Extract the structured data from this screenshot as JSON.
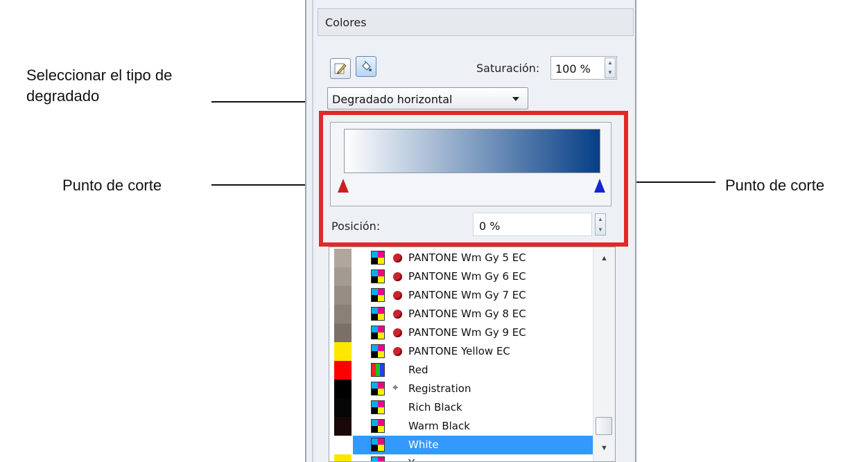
{
  "annotations": {
    "gradient_type_line1": "Seleccionar el tipo de",
    "gradient_type_line2": "degradado",
    "cut_point_left": "Punto de corte",
    "cut_point_right": "Punto de corte"
  },
  "panel": {
    "title": "Colores",
    "saturation_label": "Saturación:",
    "saturation_value": "100 %",
    "gradient_type": "Degradado horizontal",
    "position_label": "Posición:",
    "position_value": "0 %"
  },
  "gradient": {
    "start_color": "#ffffff",
    "end_color": "#063f86",
    "start_stop_color": "#cc1f1f",
    "end_stop_color": "#1428c8"
  },
  "swatches": [
    {
      "name": "PANTONE Wm Gy 5 EC",
      "color": "#b0a69d",
      "mode": "cmyk",
      "spot": true
    },
    {
      "name": "PANTONE Wm Gy 6 EC",
      "color": "#a39a91",
      "mode": "cmyk",
      "spot": true
    },
    {
      "name": "PANTONE Wm Gy 7 EC",
      "color": "#978d84",
      "mode": "cmyk",
      "spot": true
    },
    {
      "name": "PANTONE Wm Gy 8 EC",
      "color": "#8b8077",
      "mode": "cmyk",
      "spot": true
    },
    {
      "name": "PANTONE Wm Gy 9 EC",
      "color": "#7b6f66",
      "mode": "cmyk",
      "spot": true
    },
    {
      "name": "PANTONE Yellow EC",
      "color": "#ffe600",
      "mode": "cmyk",
      "spot": true
    },
    {
      "name": "Red",
      "color": "#ff0000",
      "mode": "rgb",
      "spot": false
    },
    {
      "name": "Registration",
      "color": "#000000",
      "mode": "cmyk",
      "spot": false,
      "registration": true
    },
    {
      "name": "Rich Black",
      "color": "#050505",
      "mode": "cmyk",
      "spot": false
    },
    {
      "name": "Warm Black",
      "color": "#1a0808",
      "mode": "cmyk",
      "spot": false
    },
    {
      "name": "White",
      "color": "#ffffff",
      "mode": "cmyk",
      "spot": false,
      "selected": true
    },
    {
      "name": "Y...",
      "color": "#ffe600",
      "mode": "cmyk",
      "spot": false
    }
  ]
}
